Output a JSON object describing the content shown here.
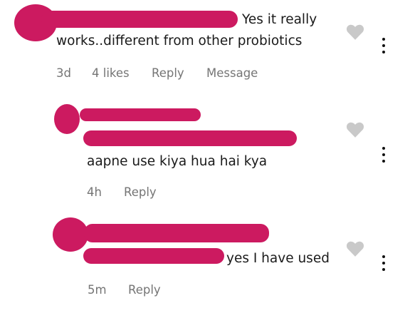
{
  "comments": [
    {
      "text_line1": "Yes it really",
      "text_line2": "works..different from other probiotics",
      "time": "3d",
      "likes": "4 likes",
      "reply": "Reply",
      "message": "Message",
      "like_icon": "heart-icon",
      "more_icon": "more-vertical-icon"
    },
    {
      "text": "aapne use kiya hua hai kya",
      "time": "4h",
      "reply": "Reply",
      "like_icon": "heart-icon",
      "more_icon": "more-vertical-icon"
    },
    {
      "text": "yes I have used",
      "time": "5m",
      "reply": "Reply",
      "like_icon": "heart-icon",
      "more_icon": "more-vertical-icon"
    }
  ],
  "colors": {
    "redaction": "#cc1a60",
    "text": "#1a1a1a",
    "meta": "#757575",
    "heart": "#c9c9c9"
  }
}
